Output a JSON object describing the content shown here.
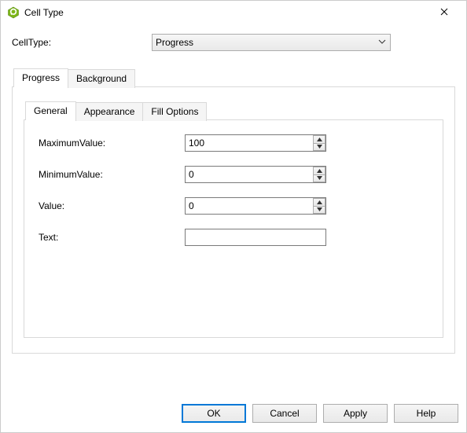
{
  "window": {
    "title": "Cell Type"
  },
  "cellTypeRow": {
    "label": "CellType:",
    "selected": "Progress"
  },
  "outerTabs": {
    "progress": "Progress",
    "background": "Background"
  },
  "innerTabs": {
    "general": "General",
    "appearance": "Appearance",
    "fillOptions": "Fill Options"
  },
  "fields": {
    "maxValue": {
      "label": "MaximumValue:",
      "value": "100"
    },
    "minValue": {
      "label": "MinimumValue:",
      "value": "0"
    },
    "value": {
      "label": "Value:",
      "value": "0"
    },
    "text": {
      "label": "Text:",
      "value": ""
    }
  },
  "buttons": {
    "ok": "OK",
    "cancel": "Cancel",
    "apply": "Apply",
    "help": "Help"
  }
}
